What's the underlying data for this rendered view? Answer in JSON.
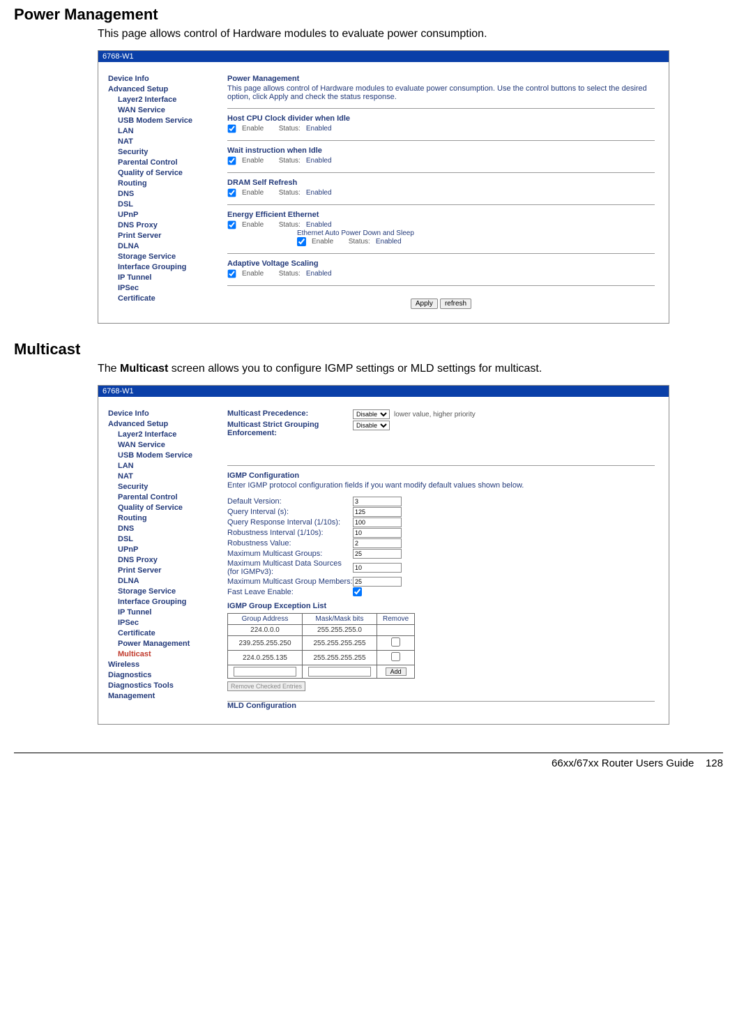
{
  "doc": {
    "section1_title": "Power Management",
    "section1_desc": "This page allows control of Hardware modules to evaluate power consumption.",
    "section2_title": "Multicast",
    "section2_desc_pre": "The ",
    "section2_desc_bold": "Multicast",
    "section2_desc_post": " screen allows you to configure IGMP settings or MLD settings for multicast.",
    "footer_guide": "66xx/67xx Router Users Guide",
    "footer_page": "128"
  },
  "shot_title": "6768-W1",
  "sidebar": {
    "top": [
      "Device Info",
      "Advanced Setup"
    ],
    "sub": [
      "Layer2 Interface",
      "WAN Service",
      "USB Modem Service",
      "LAN",
      "NAT",
      "Security",
      "Parental Control",
      "Quality of Service",
      "Routing",
      "DNS",
      "DSL",
      "UPnP",
      "DNS Proxy",
      "Print Server",
      "DLNA",
      "Storage Service",
      "Interface Grouping",
      "IP Tunnel",
      "IPSec",
      "Certificate"
    ],
    "sub2_extra": [
      "Power Management",
      "Multicast"
    ],
    "tail": [
      "Wireless",
      "Diagnostics",
      "Diagnostics Tools",
      "Management"
    ],
    "active2": "Multicast"
  },
  "pm": {
    "heading": "Power Management",
    "desc": "This page allows control of Hardware modules to evaluate power consumption. Use the control buttons to select the desired option, click Apply and check the status response.",
    "enable_label": "Enable",
    "status_prefix": "Status:",
    "status_enabled": "Enabled",
    "blocks": [
      "Host CPU Clock divider when Idle",
      "Wait instruction when Idle",
      "DRAM Self Refresh",
      "Energy Efficient Ethernet",
      "Adaptive Voltage Scaling"
    ],
    "eee_sub": "Ethernet Auto Power Down and Sleep",
    "apply": "Apply",
    "refresh": "refresh"
  },
  "mc": {
    "precedence_label": "Multicast Precedence:",
    "strict_label": "Multicast Strict Grouping Enforcement:",
    "precedence_opt": "Disable",
    "strict_opt": "Disable",
    "precedence_hint": "lower value, higher priority",
    "igmp_heading": "IGMP Configuration",
    "igmp_desc": "Enter IGMP protocol configuration fields if you want modify default values shown below.",
    "fields": [
      {
        "label": "Default Version:",
        "value": "3"
      },
      {
        "label": "Query Interval (s):",
        "value": "125"
      },
      {
        "label": "Query Response Interval (1/10s):",
        "value": "100"
      },
      {
        "label": "Robustness Interval (1/10s):",
        "value": "10"
      },
      {
        "label": "Robustness Value:",
        "value": "2"
      },
      {
        "label": "Maximum Multicast Groups:",
        "value": "25"
      },
      {
        "label": "Maximum Multicast Data Sources (for IGMPv3):",
        "value": "10"
      },
      {
        "label": "Maximum Multicast Group Members:",
        "value": "25"
      }
    ],
    "fast_leave": "Fast Leave Enable:",
    "exc_heading": "IGMP Group Exception List",
    "exc_cols": [
      "Group Address",
      "Mask/Mask bits",
      "Remove"
    ],
    "exc_rows": [
      {
        "addr": "224.0.0.0",
        "mask": "255.255.255.0",
        "rm": false,
        "first": true
      },
      {
        "addr": "239.255.255.250",
        "mask": "255.255.255.255",
        "rm": false,
        "first": false
      },
      {
        "addr": "224.0.255.135",
        "mask": "255.255.255.255",
        "rm": false,
        "first": false
      }
    ],
    "add": "Add",
    "remove_checked": "Remove Checked Entries",
    "mld_heading": "MLD Configuration"
  }
}
